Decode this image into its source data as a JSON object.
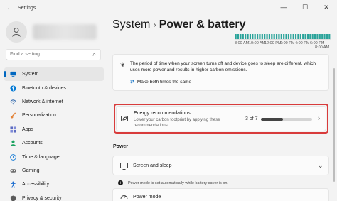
{
  "window": {
    "title": "Settings",
    "back_icon": "back-arrow-icon",
    "controls": [
      "—",
      "☐",
      "✕"
    ]
  },
  "profile": {
    "avatar_icon": "person-icon"
  },
  "search": {
    "placeholder": "Find a setting",
    "icon": "search-icon"
  },
  "sidebar": {
    "items": [
      {
        "label": "System",
        "icon": "monitor-icon",
        "color": "#0067c0",
        "active": true
      },
      {
        "label": "Bluetooth & devices",
        "icon": "bluetooth-icon",
        "color": "#0078d4"
      },
      {
        "label": "Network & internet",
        "icon": "wifi-icon",
        "color": "#3a6fb0"
      },
      {
        "label": "Personalization",
        "icon": "brush-icon",
        "color": "#e3843a"
      },
      {
        "label": "Apps",
        "icon": "apps-icon",
        "color": "#5c6bc0"
      },
      {
        "label": "Accounts",
        "icon": "accounts-icon",
        "color": "#1aa260"
      },
      {
        "label": "Time & language",
        "icon": "globe-clock-icon",
        "color": "#1d7fd6"
      },
      {
        "label": "Gaming",
        "icon": "gamepad-icon",
        "color": "#6b6b6b"
      },
      {
        "label": "Accessibility",
        "icon": "accessibility-icon",
        "color": "#1c6dd0"
      },
      {
        "label": "Privacy & security",
        "icon": "shield-icon",
        "color": "#5a5a5a"
      }
    ]
  },
  "breadcrumb": {
    "parent": "System",
    "separator": "›",
    "current": "Power & battery"
  },
  "usage_chart": {
    "bar_color": "#2aa39a",
    "time_labels": [
      "8:00 AM",
      "10:00 AM",
      "12:00 PM",
      "2:00 PM",
      "4:00 PM",
      "6:00 PM",
      "8:00 AM"
    ]
  },
  "info_card": {
    "icon": "leaf-icon",
    "text": "The period of time when your screen turns off and device goes to sleep are different, which uses more power and results in higher carbon emissions.",
    "link": "Make both times the same",
    "link_icon": "sync-icon"
  },
  "energy": {
    "icon": "energy-recommendations-icon",
    "title": "Energy recommendations",
    "description": "Lower your carbon footprint by applying these recommendations",
    "count": "3 of 7",
    "progress_fraction": 0.43,
    "highlight_color": "#d83b3b"
  },
  "power_section": {
    "title": "Power"
  },
  "screen_sleep": {
    "label": "Screen and sleep",
    "icon": "screen-sleep-icon"
  },
  "notice": {
    "text": "Power mode is set automatically while battery saver is on.",
    "icon": "info-icon"
  },
  "power_mode": {
    "label": "Power mode",
    "icon": "power-mode-icon"
  }
}
